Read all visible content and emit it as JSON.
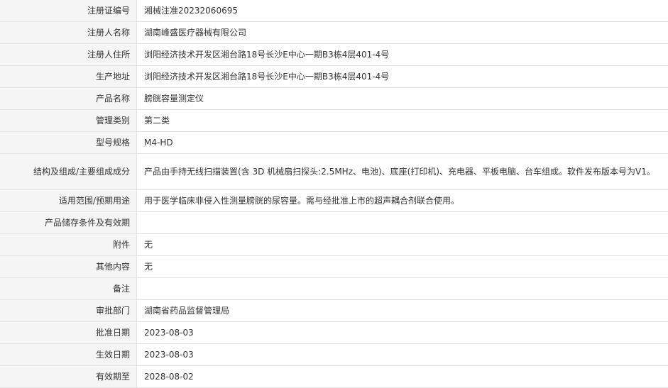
{
  "rows": [
    {
      "label": "注册证编号",
      "value": "湘械注准20232060695"
    },
    {
      "label": "注册人名称",
      "value": "湖南峰盛医疗器械有限公司"
    },
    {
      "label": "注册人住所",
      "value": "浏阳经济技术开发区湘台路18号长沙E中心一期B3栋4层401-4号"
    },
    {
      "label": "生产地址",
      "value": "浏阳经济技术开发区湘台路18号长沙E中心一期B3栋4层401-4号"
    },
    {
      "label": "产品名称",
      "value": "膀胱容量测定仪"
    },
    {
      "label": "管理类别",
      "value": "第二类"
    },
    {
      "label": "型号规格",
      "value": "M4-HD"
    },
    {
      "label": "结构及组成/主要组成成分",
      "value": "产品由手持无线扫描装置(含 3D 机械扇扫探头:2.5MHz、电池)、底座(打印机)、充电器、平板电脑、台车组成。软件发布版本号为V1。"
    },
    {
      "label": "适用范围/预期用途",
      "value": "用于医学临床非侵入性测量膀胱的尿容量。需与经批准上市的超声耦合剂联合使用。"
    },
    {
      "label": "产品储存条件及有效期",
      "value": ""
    },
    {
      "label": "附件",
      "value": "无"
    },
    {
      "label": "其他内容",
      "value": "无"
    },
    {
      "label": "备注",
      "value": ""
    },
    {
      "label": "审批部门",
      "value": "湖南省药品监督管理局"
    },
    {
      "label": "批准日期",
      "value": "2023-08-03"
    },
    {
      "label": "生效日期",
      "value": "2023-08-03"
    },
    {
      "label": "有效期至",
      "value": "2028-08-02"
    }
  ]
}
